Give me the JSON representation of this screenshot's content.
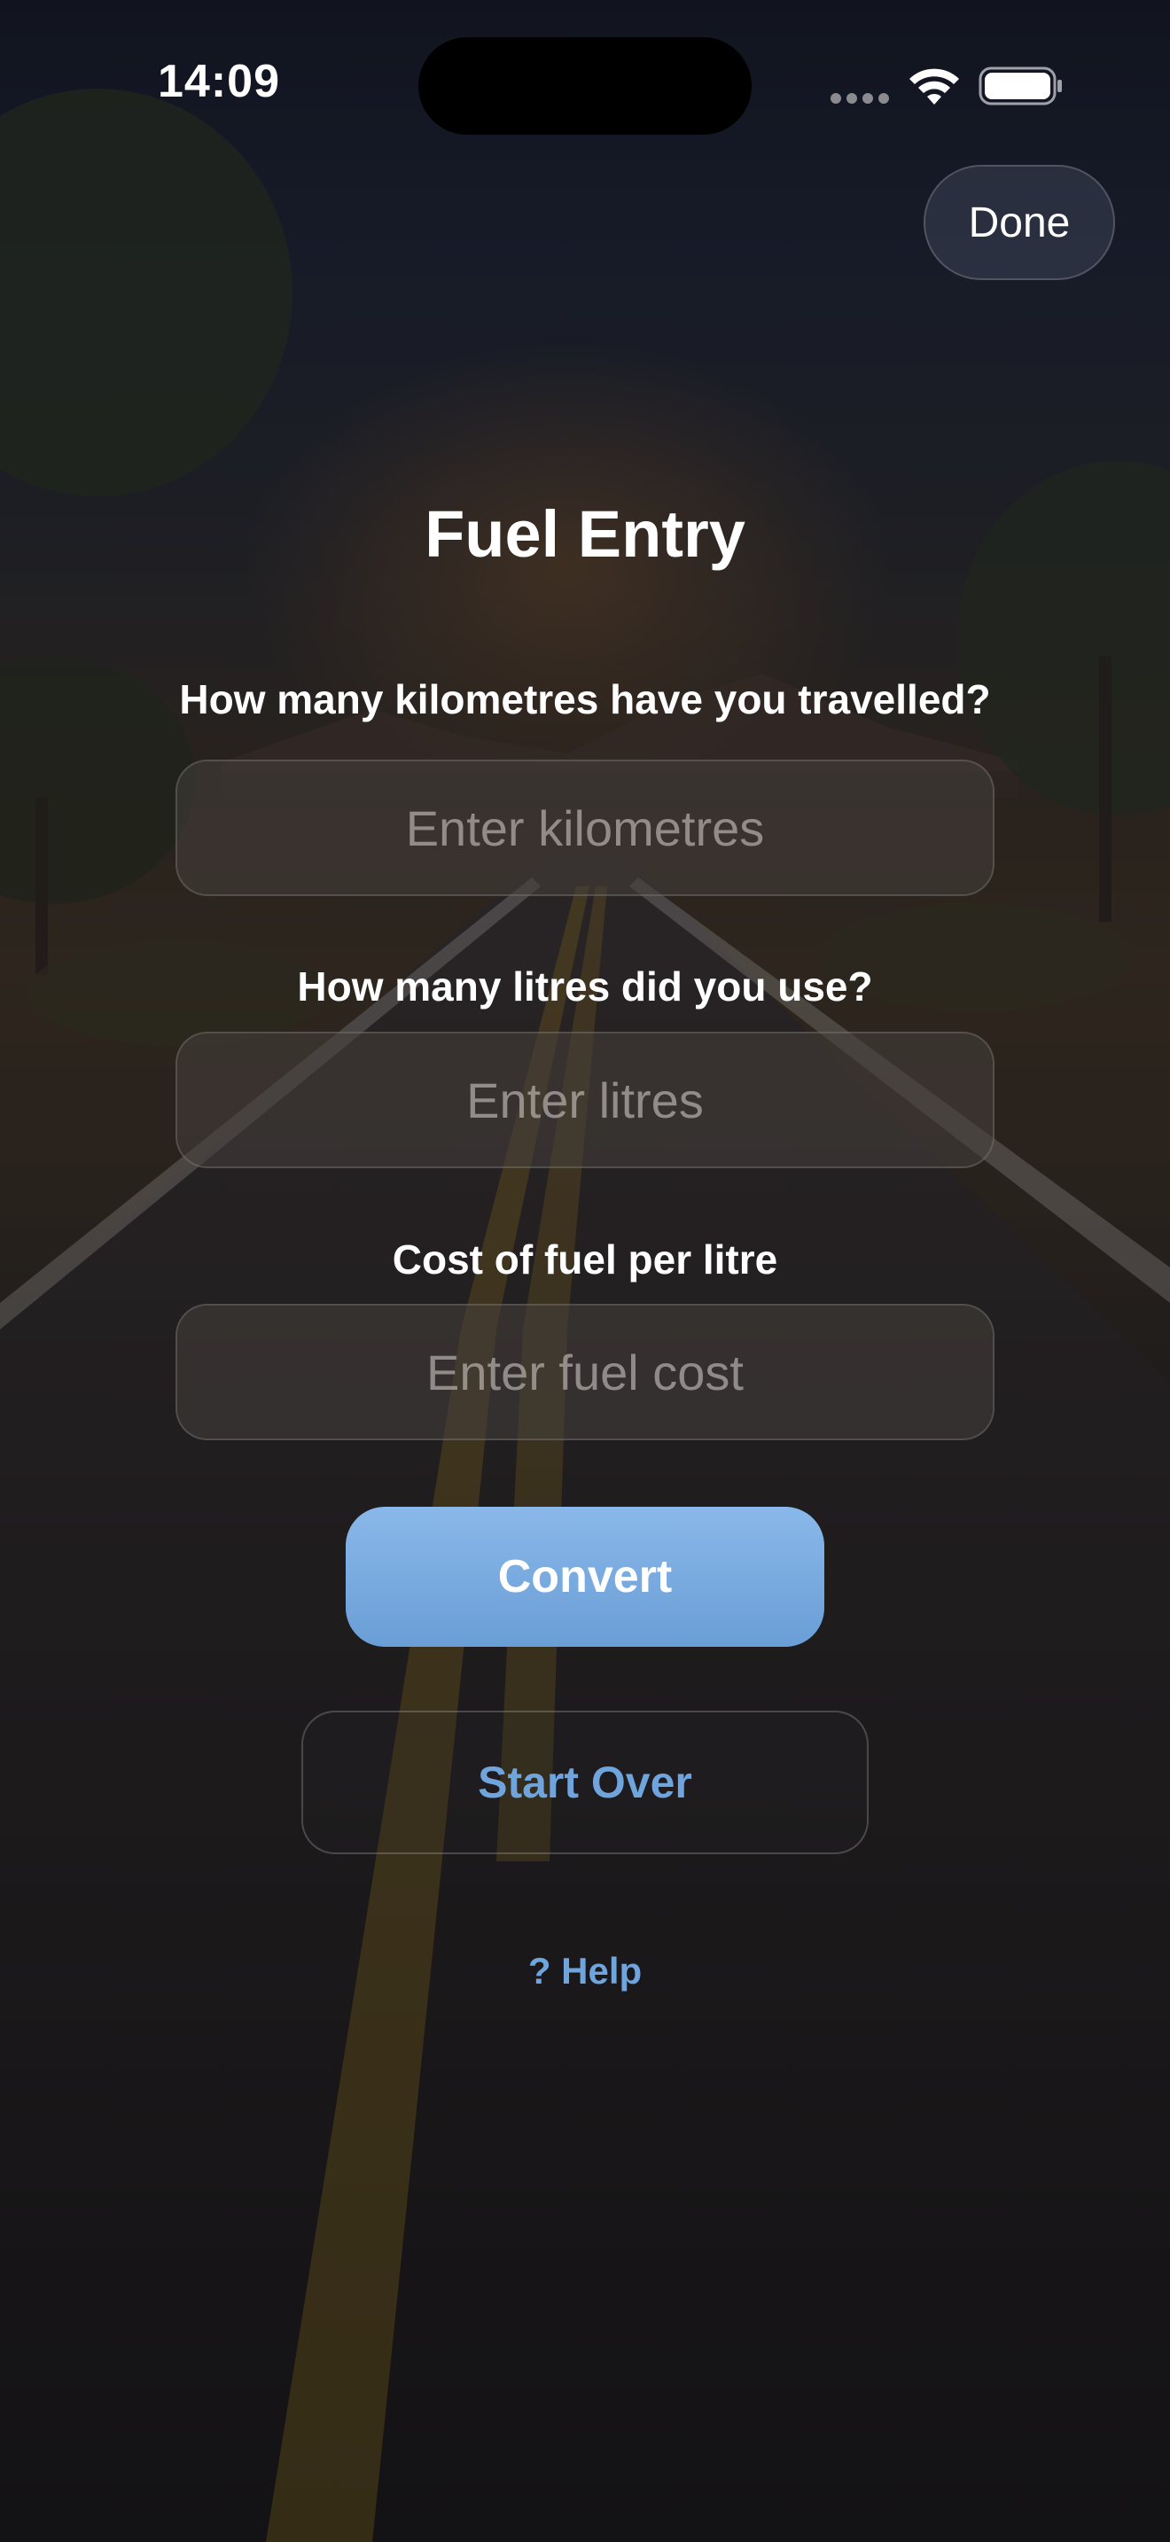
{
  "status_bar": {
    "time": "14:09",
    "icons": [
      "signal-icon",
      "wifi-icon",
      "battery-icon"
    ]
  },
  "header": {
    "done_label": "Done"
  },
  "form": {
    "title": "Fuel Entry",
    "kilometres": {
      "label": "How many kilometres have you travelled?",
      "placeholder": "Enter kilometres",
      "value": ""
    },
    "litres": {
      "label": "How many litres did you use?",
      "placeholder": "Enter litres",
      "value": ""
    },
    "fuel_cost": {
      "label": "Cost of fuel per litre",
      "placeholder": "Enter fuel cost",
      "value": ""
    }
  },
  "actions": {
    "convert_label": "Convert",
    "start_over_label": "Start Over",
    "help_label": "? Help"
  },
  "colors": {
    "accent": "#6fa4dd",
    "primary_button": "#7aaee2",
    "text": "#ffffff"
  }
}
